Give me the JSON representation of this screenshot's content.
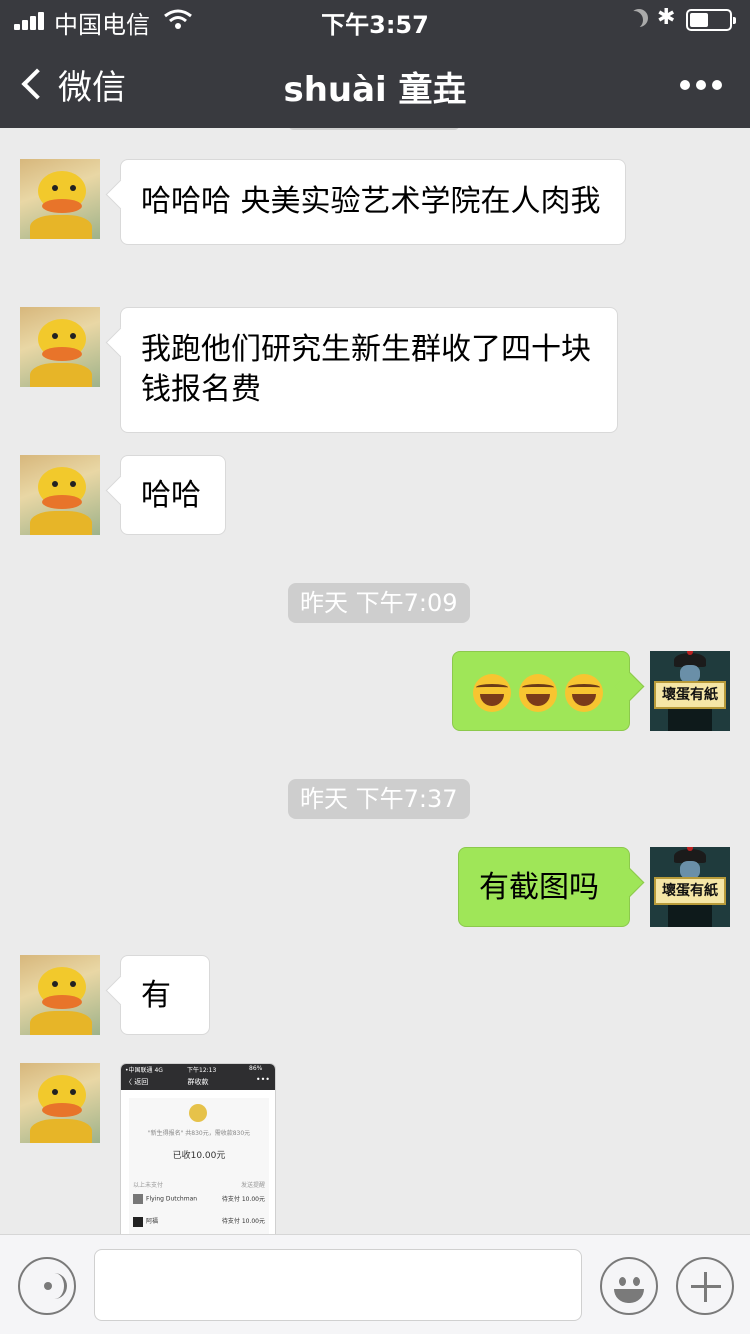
{
  "status": {
    "carrier": "中国电信",
    "time": "下午3:57",
    "bluetooth": "✱",
    "battery_level": 0.4
  },
  "nav": {
    "back_label": "微信",
    "title": "shuài 童垚",
    "more_icon": "more-dots-icon"
  },
  "messages": {
    "m1": "哈哈哈 央美实验艺术学院在人肉我",
    "m2": "我跑他们研究生新生群收了四十块钱报名费",
    "m3": "哈哈",
    "t1": "昨天 下午7:09",
    "t2": "昨天 下午7:37",
    "m5": "有截图吗",
    "m6": "有"
  },
  "avatar_me_text": "壞蛋有紙",
  "thumb": {
    "status_left": "•中国联通 4G",
    "status_time": "下午12:13",
    "status_right": "86%",
    "back": "〈 返回",
    "title": "群收款",
    "more": "•••",
    "line1": "\"新生得报名\" 共830元，需收款830元",
    "amount": "已收10.00元",
    "section_left": "以上未支付",
    "section_right": "发送提醒",
    "row1_name": "Flying Dutchman",
    "row1_status": "待支付 10.00元",
    "row2_name": "阿福",
    "row2_status": "待支付 10.00元"
  }
}
